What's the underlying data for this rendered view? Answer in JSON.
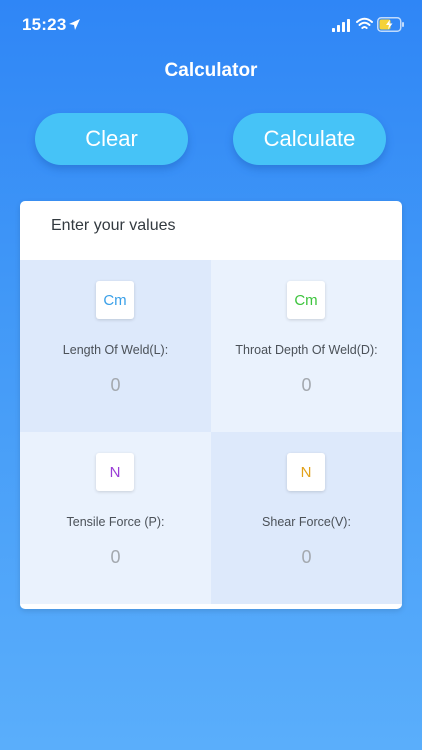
{
  "status_bar": {
    "time": "15:23",
    "icons": [
      "location-arrow-icon",
      "cellular-signal-icon",
      "wifi-icon",
      "battery-charging-icon"
    ]
  },
  "header": {
    "title": "Calculator"
  },
  "actions": {
    "clear_label": "Clear",
    "calculate_label": "Calculate"
  },
  "form": {
    "title": "Enter your values",
    "fields": [
      {
        "unit": "Cm",
        "unit_color": "#3aa0e8",
        "label": "Length Of Weld(L):",
        "value": "0"
      },
      {
        "unit": "Cm",
        "unit_color": "#3ec43e",
        "label": "Throat Depth Of Weld(D):",
        "value": "0"
      },
      {
        "unit": "N",
        "unit_color": "#9a3fd6",
        "label": "Tensile Force (P):",
        "value": "0"
      },
      {
        "unit": "N",
        "unit_color": "#e2a21a",
        "label": "Shear Force(V):",
        "value": "0"
      }
    ]
  },
  "colors": {
    "background_top": "#2f86f6",
    "background_bottom": "#5aaefb",
    "button": "#46c3f7"
  }
}
